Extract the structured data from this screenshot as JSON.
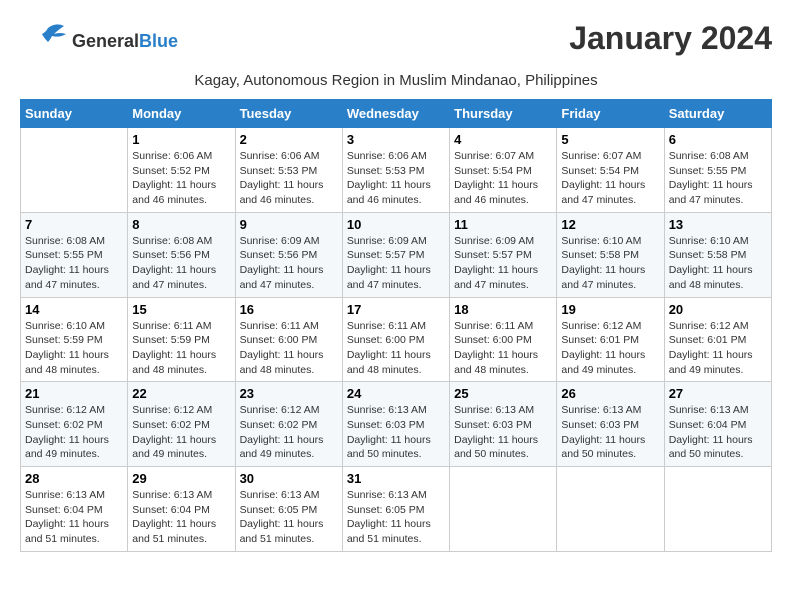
{
  "logo": {
    "general": "General",
    "blue": "Blue"
  },
  "title": "January 2024",
  "subtitle": "Kagay, Autonomous Region in Muslim Mindanao, Philippines",
  "days_header": [
    "Sunday",
    "Monday",
    "Tuesday",
    "Wednesday",
    "Thursday",
    "Friday",
    "Saturday"
  ],
  "weeks": [
    [
      {
        "num": "",
        "info": ""
      },
      {
        "num": "1",
        "info": "Sunrise: 6:06 AM\nSunset: 5:52 PM\nDaylight: 11 hours and 46 minutes."
      },
      {
        "num": "2",
        "info": "Sunrise: 6:06 AM\nSunset: 5:53 PM\nDaylight: 11 hours and 46 minutes."
      },
      {
        "num": "3",
        "info": "Sunrise: 6:06 AM\nSunset: 5:53 PM\nDaylight: 11 hours and 46 minutes."
      },
      {
        "num": "4",
        "info": "Sunrise: 6:07 AM\nSunset: 5:54 PM\nDaylight: 11 hours and 46 minutes."
      },
      {
        "num": "5",
        "info": "Sunrise: 6:07 AM\nSunset: 5:54 PM\nDaylight: 11 hours and 47 minutes."
      },
      {
        "num": "6",
        "info": "Sunrise: 6:08 AM\nSunset: 5:55 PM\nDaylight: 11 hours and 47 minutes."
      }
    ],
    [
      {
        "num": "7",
        "info": "Sunrise: 6:08 AM\nSunset: 5:55 PM\nDaylight: 11 hours and 47 minutes."
      },
      {
        "num": "8",
        "info": "Sunrise: 6:08 AM\nSunset: 5:56 PM\nDaylight: 11 hours and 47 minutes."
      },
      {
        "num": "9",
        "info": "Sunrise: 6:09 AM\nSunset: 5:56 PM\nDaylight: 11 hours and 47 minutes."
      },
      {
        "num": "10",
        "info": "Sunrise: 6:09 AM\nSunset: 5:57 PM\nDaylight: 11 hours and 47 minutes."
      },
      {
        "num": "11",
        "info": "Sunrise: 6:09 AM\nSunset: 5:57 PM\nDaylight: 11 hours and 47 minutes."
      },
      {
        "num": "12",
        "info": "Sunrise: 6:10 AM\nSunset: 5:58 PM\nDaylight: 11 hours and 47 minutes."
      },
      {
        "num": "13",
        "info": "Sunrise: 6:10 AM\nSunset: 5:58 PM\nDaylight: 11 hours and 48 minutes."
      }
    ],
    [
      {
        "num": "14",
        "info": "Sunrise: 6:10 AM\nSunset: 5:59 PM\nDaylight: 11 hours and 48 minutes."
      },
      {
        "num": "15",
        "info": "Sunrise: 6:11 AM\nSunset: 5:59 PM\nDaylight: 11 hours and 48 minutes."
      },
      {
        "num": "16",
        "info": "Sunrise: 6:11 AM\nSunset: 6:00 PM\nDaylight: 11 hours and 48 minutes."
      },
      {
        "num": "17",
        "info": "Sunrise: 6:11 AM\nSunset: 6:00 PM\nDaylight: 11 hours and 48 minutes."
      },
      {
        "num": "18",
        "info": "Sunrise: 6:11 AM\nSunset: 6:00 PM\nDaylight: 11 hours and 48 minutes."
      },
      {
        "num": "19",
        "info": "Sunrise: 6:12 AM\nSunset: 6:01 PM\nDaylight: 11 hours and 49 minutes."
      },
      {
        "num": "20",
        "info": "Sunrise: 6:12 AM\nSunset: 6:01 PM\nDaylight: 11 hours and 49 minutes."
      }
    ],
    [
      {
        "num": "21",
        "info": "Sunrise: 6:12 AM\nSunset: 6:02 PM\nDaylight: 11 hours and 49 minutes."
      },
      {
        "num": "22",
        "info": "Sunrise: 6:12 AM\nSunset: 6:02 PM\nDaylight: 11 hours and 49 minutes."
      },
      {
        "num": "23",
        "info": "Sunrise: 6:12 AM\nSunset: 6:02 PM\nDaylight: 11 hours and 49 minutes."
      },
      {
        "num": "24",
        "info": "Sunrise: 6:13 AM\nSunset: 6:03 PM\nDaylight: 11 hours and 50 minutes."
      },
      {
        "num": "25",
        "info": "Sunrise: 6:13 AM\nSunset: 6:03 PM\nDaylight: 11 hours and 50 minutes."
      },
      {
        "num": "26",
        "info": "Sunrise: 6:13 AM\nSunset: 6:03 PM\nDaylight: 11 hours and 50 minutes."
      },
      {
        "num": "27",
        "info": "Sunrise: 6:13 AM\nSunset: 6:04 PM\nDaylight: 11 hours and 50 minutes."
      }
    ],
    [
      {
        "num": "28",
        "info": "Sunrise: 6:13 AM\nSunset: 6:04 PM\nDaylight: 11 hours and 51 minutes."
      },
      {
        "num": "29",
        "info": "Sunrise: 6:13 AM\nSunset: 6:04 PM\nDaylight: 11 hours and 51 minutes."
      },
      {
        "num": "30",
        "info": "Sunrise: 6:13 AM\nSunset: 6:05 PM\nDaylight: 11 hours and 51 minutes."
      },
      {
        "num": "31",
        "info": "Sunrise: 6:13 AM\nSunset: 6:05 PM\nDaylight: 11 hours and 51 minutes."
      },
      {
        "num": "",
        "info": ""
      },
      {
        "num": "",
        "info": ""
      },
      {
        "num": "",
        "info": ""
      }
    ]
  ]
}
